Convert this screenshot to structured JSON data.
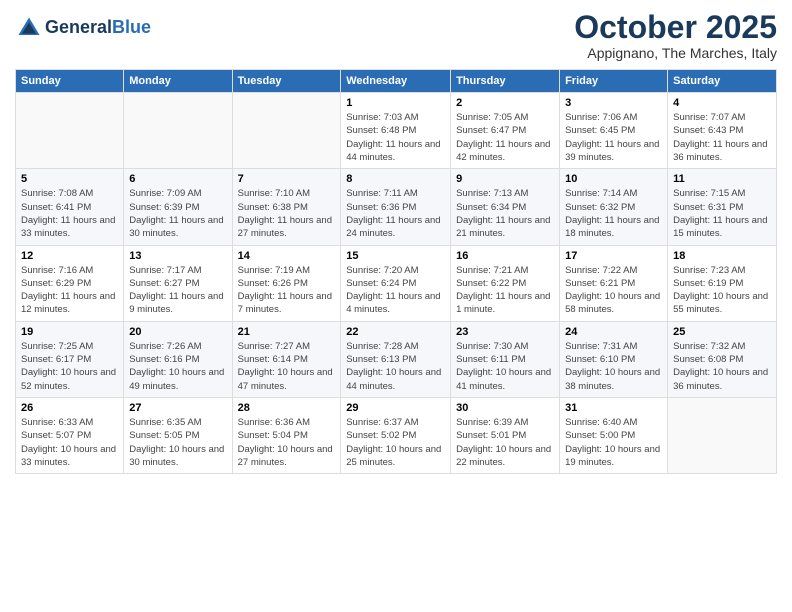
{
  "header": {
    "logo_line1": "General",
    "logo_line2": "Blue",
    "month": "October 2025",
    "location": "Appignano, The Marches, Italy"
  },
  "days_of_week": [
    "Sunday",
    "Monday",
    "Tuesday",
    "Wednesday",
    "Thursday",
    "Friday",
    "Saturday"
  ],
  "weeks": [
    [
      {
        "day": "",
        "info": ""
      },
      {
        "day": "",
        "info": ""
      },
      {
        "day": "",
        "info": ""
      },
      {
        "day": "1",
        "info": "Sunrise: 7:03 AM\nSunset: 6:48 PM\nDaylight: 11 hours and 44 minutes."
      },
      {
        "day": "2",
        "info": "Sunrise: 7:05 AM\nSunset: 6:47 PM\nDaylight: 11 hours and 42 minutes."
      },
      {
        "day": "3",
        "info": "Sunrise: 7:06 AM\nSunset: 6:45 PM\nDaylight: 11 hours and 39 minutes."
      },
      {
        "day": "4",
        "info": "Sunrise: 7:07 AM\nSunset: 6:43 PM\nDaylight: 11 hours and 36 minutes."
      }
    ],
    [
      {
        "day": "5",
        "info": "Sunrise: 7:08 AM\nSunset: 6:41 PM\nDaylight: 11 hours and 33 minutes."
      },
      {
        "day": "6",
        "info": "Sunrise: 7:09 AM\nSunset: 6:39 PM\nDaylight: 11 hours and 30 minutes."
      },
      {
        "day": "7",
        "info": "Sunrise: 7:10 AM\nSunset: 6:38 PM\nDaylight: 11 hours and 27 minutes."
      },
      {
        "day": "8",
        "info": "Sunrise: 7:11 AM\nSunset: 6:36 PM\nDaylight: 11 hours and 24 minutes."
      },
      {
        "day": "9",
        "info": "Sunrise: 7:13 AM\nSunset: 6:34 PM\nDaylight: 11 hours and 21 minutes."
      },
      {
        "day": "10",
        "info": "Sunrise: 7:14 AM\nSunset: 6:32 PM\nDaylight: 11 hours and 18 minutes."
      },
      {
        "day": "11",
        "info": "Sunrise: 7:15 AM\nSunset: 6:31 PM\nDaylight: 11 hours and 15 minutes."
      }
    ],
    [
      {
        "day": "12",
        "info": "Sunrise: 7:16 AM\nSunset: 6:29 PM\nDaylight: 11 hours and 12 minutes."
      },
      {
        "day": "13",
        "info": "Sunrise: 7:17 AM\nSunset: 6:27 PM\nDaylight: 11 hours and 9 minutes."
      },
      {
        "day": "14",
        "info": "Sunrise: 7:19 AM\nSunset: 6:26 PM\nDaylight: 11 hours and 7 minutes."
      },
      {
        "day": "15",
        "info": "Sunrise: 7:20 AM\nSunset: 6:24 PM\nDaylight: 11 hours and 4 minutes."
      },
      {
        "day": "16",
        "info": "Sunrise: 7:21 AM\nSunset: 6:22 PM\nDaylight: 11 hours and 1 minute."
      },
      {
        "day": "17",
        "info": "Sunrise: 7:22 AM\nSunset: 6:21 PM\nDaylight: 10 hours and 58 minutes."
      },
      {
        "day": "18",
        "info": "Sunrise: 7:23 AM\nSunset: 6:19 PM\nDaylight: 10 hours and 55 minutes."
      }
    ],
    [
      {
        "day": "19",
        "info": "Sunrise: 7:25 AM\nSunset: 6:17 PM\nDaylight: 10 hours and 52 minutes."
      },
      {
        "day": "20",
        "info": "Sunrise: 7:26 AM\nSunset: 6:16 PM\nDaylight: 10 hours and 49 minutes."
      },
      {
        "day": "21",
        "info": "Sunrise: 7:27 AM\nSunset: 6:14 PM\nDaylight: 10 hours and 47 minutes."
      },
      {
        "day": "22",
        "info": "Sunrise: 7:28 AM\nSunset: 6:13 PM\nDaylight: 10 hours and 44 minutes."
      },
      {
        "day": "23",
        "info": "Sunrise: 7:30 AM\nSunset: 6:11 PM\nDaylight: 10 hours and 41 minutes."
      },
      {
        "day": "24",
        "info": "Sunrise: 7:31 AM\nSunset: 6:10 PM\nDaylight: 10 hours and 38 minutes."
      },
      {
        "day": "25",
        "info": "Sunrise: 7:32 AM\nSunset: 6:08 PM\nDaylight: 10 hours and 36 minutes."
      }
    ],
    [
      {
        "day": "26",
        "info": "Sunrise: 6:33 AM\nSunset: 5:07 PM\nDaylight: 10 hours and 33 minutes."
      },
      {
        "day": "27",
        "info": "Sunrise: 6:35 AM\nSunset: 5:05 PM\nDaylight: 10 hours and 30 minutes."
      },
      {
        "day": "28",
        "info": "Sunrise: 6:36 AM\nSunset: 5:04 PM\nDaylight: 10 hours and 27 minutes."
      },
      {
        "day": "29",
        "info": "Sunrise: 6:37 AM\nSunset: 5:02 PM\nDaylight: 10 hours and 25 minutes."
      },
      {
        "day": "30",
        "info": "Sunrise: 6:39 AM\nSunset: 5:01 PM\nDaylight: 10 hours and 22 minutes."
      },
      {
        "day": "31",
        "info": "Sunrise: 6:40 AM\nSunset: 5:00 PM\nDaylight: 10 hours and 19 minutes."
      },
      {
        "day": "",
        "info": ""
      }
    ]
  ]
}
